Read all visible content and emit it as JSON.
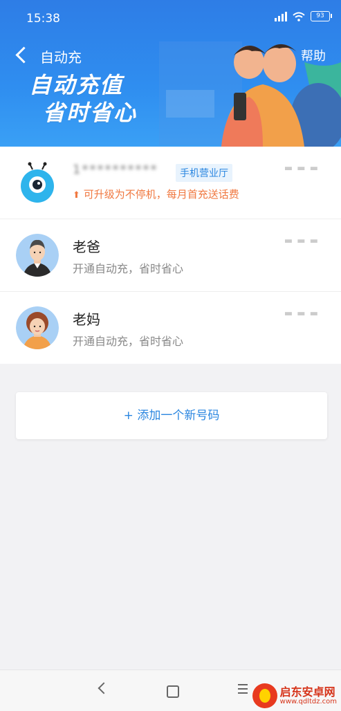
{
  "status_bar": {
    "time": "15:38",
    "battery": "93"
  },
  "header": {
    "title": "自动充",
    "help_label": "帮助"
  },
  "banner": {
    "slogan_line1": "自动充值",
    "slogan_line2": "省时省心"
  },
  "contacts": [
    {
      "name": "1**********",
      "tag": "手机营业厅",
      "subtitle": "可升级为不停机，每月首充送话费"
    },
    {
      "name": "老爸",
      "subtitle": "开通自动充，省时省心"
    },
    {
      "name": "老妈",
      "subtitle": "开通自动充，省时省心"
    }
  ],
  "add_number_label": "+ 添加一个新号码",
  "watermark": {
    "title": "启东安卓网",
    "url": "www.qdltdz.com"
  },
  "colors": {
    "primary": "#2e7de6",
    "accent_text": "#2a86e0",
    "warning_orange": "#f07840"
  }
}
